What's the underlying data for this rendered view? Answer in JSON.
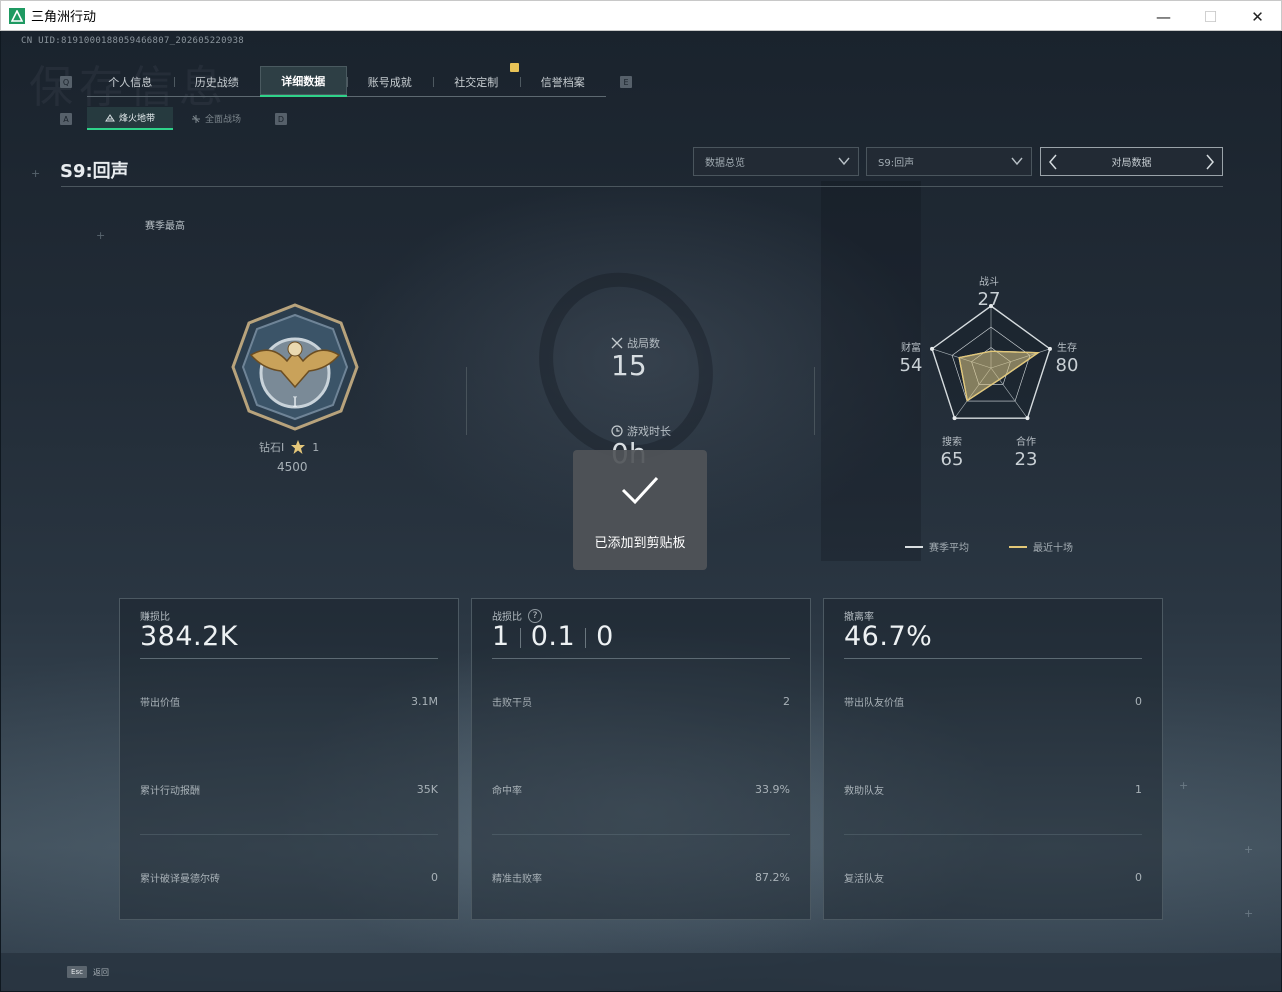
{
  "window": {
    "title": "三角洲行动",
    "minimize": "—",
    "maximize": "☐",
    "close": "✕"
  },
  "uid": "CN UID:8191000188059466807_202605220938",
  "watermark": "保存信息",
  "tab_hints": {
    "left": "Q",
    "right": "E"
  },
  "tabs": [
    {
      "label": "个人信息",
      "active": false
    },
    {
      "label": "历史战绩",
      "active": false
    },
    {
      "label": "详细数据",
      "active": true
    },
    {
      "label": "账号成就",
      "active": false
    },
    {
      "label": "社交定制",
      "active": false
    },
    {
      "label": "信誉档案",
      "active": false
    }
  ],
  "subtab_hints": {
    "left": "A",
    "right": "D"
  },
  "subtabs": [
    {
      "label": "烽火地带",
      "icon": "hazard-zone-icon",
      "active": true
    },
    {
      "label": "全面战场",
      "icon": "battlefield-icon",
      "active": false
    }
  ],
  "season_title": "S9:回声",
  "filters": {
    "data_type": "数据总览",
    "season": "S9:回声",
    "pager_label": "对局数据"
  },
  "season_best_label": "赛季最高",
  "rank": {
    "name": "钻石I",
    "stars": "1",
    "score": "4500"
  },
  "matches": {
    "label": "战局数",
    "value": "15",
    "icon": "crossed-swords-icon"
  },
  "playtime": {
    "label": "游戏时长",
    "value": "0h",
    "icon": "clock-icon"
  },
  "radar": {
    "axes": [
      {
        "label": "战斗",
        "value": "27"
      },
      {
        "label": "生存",
        "value": "80"
      },
      {
        "label": "合作",
        "value": "23"
      },
      {
        "label": "搜索",
        "value": "65"
      },
      {
        "label": "财富",
        "value": "54"
      }
    ],
    "series": [
      {
        "name": "赛季平均",
        "color": "#d8dde0",
        "values": [
          27,
          80,
          23,
          65,
          54
        ]
      },
      {
        "name": "最近十场",
        "color": "#e2c777",
        "values": [
          27,
          80,
          23,
          65,
          54
        ]
      }
    ]
  },
  "cards": [
    {
      "title": "赚损比",
      "value": "384.2K",
      "rows": [
        {
          "label": "带出价值",
          "value": "3.1M"
        },
        {
          "label": "累计行动报酬",
          "value": "35K"
        },
        {
          "label": "累计破译曼德尔砖",
          "value": "0"
        }
      ]
    },
    {
      "title": "战损比",
      "help": "?",
      "kd": [
        "1",
        "0.1",
        "0"
      ],
      "rows": [
        {
          "label": "击败干员",
          "value": "2"
        },
        {
          "label": "命中率",
          "value": "33.9%"
        },
        {
          "label": "精准击败率",
          "value": "87.2%"
        }
      ]
    },
    {
      "title": "撤离率",
      "value": "46.7%",
      "rows": [
        {
          "label": "带出队友价值",
          "value": "0"
        },
        {
          "label": "救助队友",
          "value": "1"
        },
        {
          "label": "复活队友",
          "value": "0"
        }
      ]
    }
  ],
  "toast": {
    "message": "已添加到剪贴板",
    "icon": "checkmark-icon"
  },
  "footer": {
    "key": "Esc",
    "label": "返回"
  }
}
